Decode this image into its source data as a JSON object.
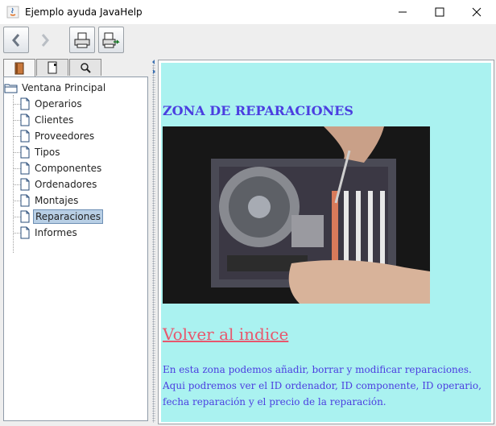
{
  "window": {
    "title": "Ejemplo ayuda JavaHelp"
  },
  "toolbar": {
    "buttons": [
      {
        "name": "back",
        "icon": "back-arrow-icon"
      },
      {
        "name": "forward",
        "icon": "forward-arrow-icon"
      },
      {
        "name": "print",
        "icon": "print-icon"
      },
      {
        "name": "page-setup",
        "icon": "page-setup-icon"
      }
    ]
  },
  "tabs": [
    {
      "icon": "toc-book-icon",
      "active": true
    },
    {
      "icon": "index-icon",
      "active": false
    },
    {
      "icon": "search-icon",
      "active": false
    }
  ],
  "tree": {
    "root": "Ventana Principal",
    "items": [
      "Operarios",
      "Clientes",
      "Proveedores",
      "Tipos",
      "Componentes",
      "Ordenadores",
      "Montajes",
      "Reparaciones",
      "Informes"
    ],
    "selected": "Reparaciones"
  },
  "content": {
    "heading": "ZONA DE REPARACIONES",
    "link": "Volver al indice",
    "paragraph": "En esta zona podemos añadir, borrar y modificar reparaciones. Aqui podremos ver el ID ordenador, ID componente, ID operario, fecha reparación y el precio de la reparación.",
    "background": "#aaf2f0",
    "text_color": "#4b3ee0",
    "link_color": "#e8576d"
  }
}
